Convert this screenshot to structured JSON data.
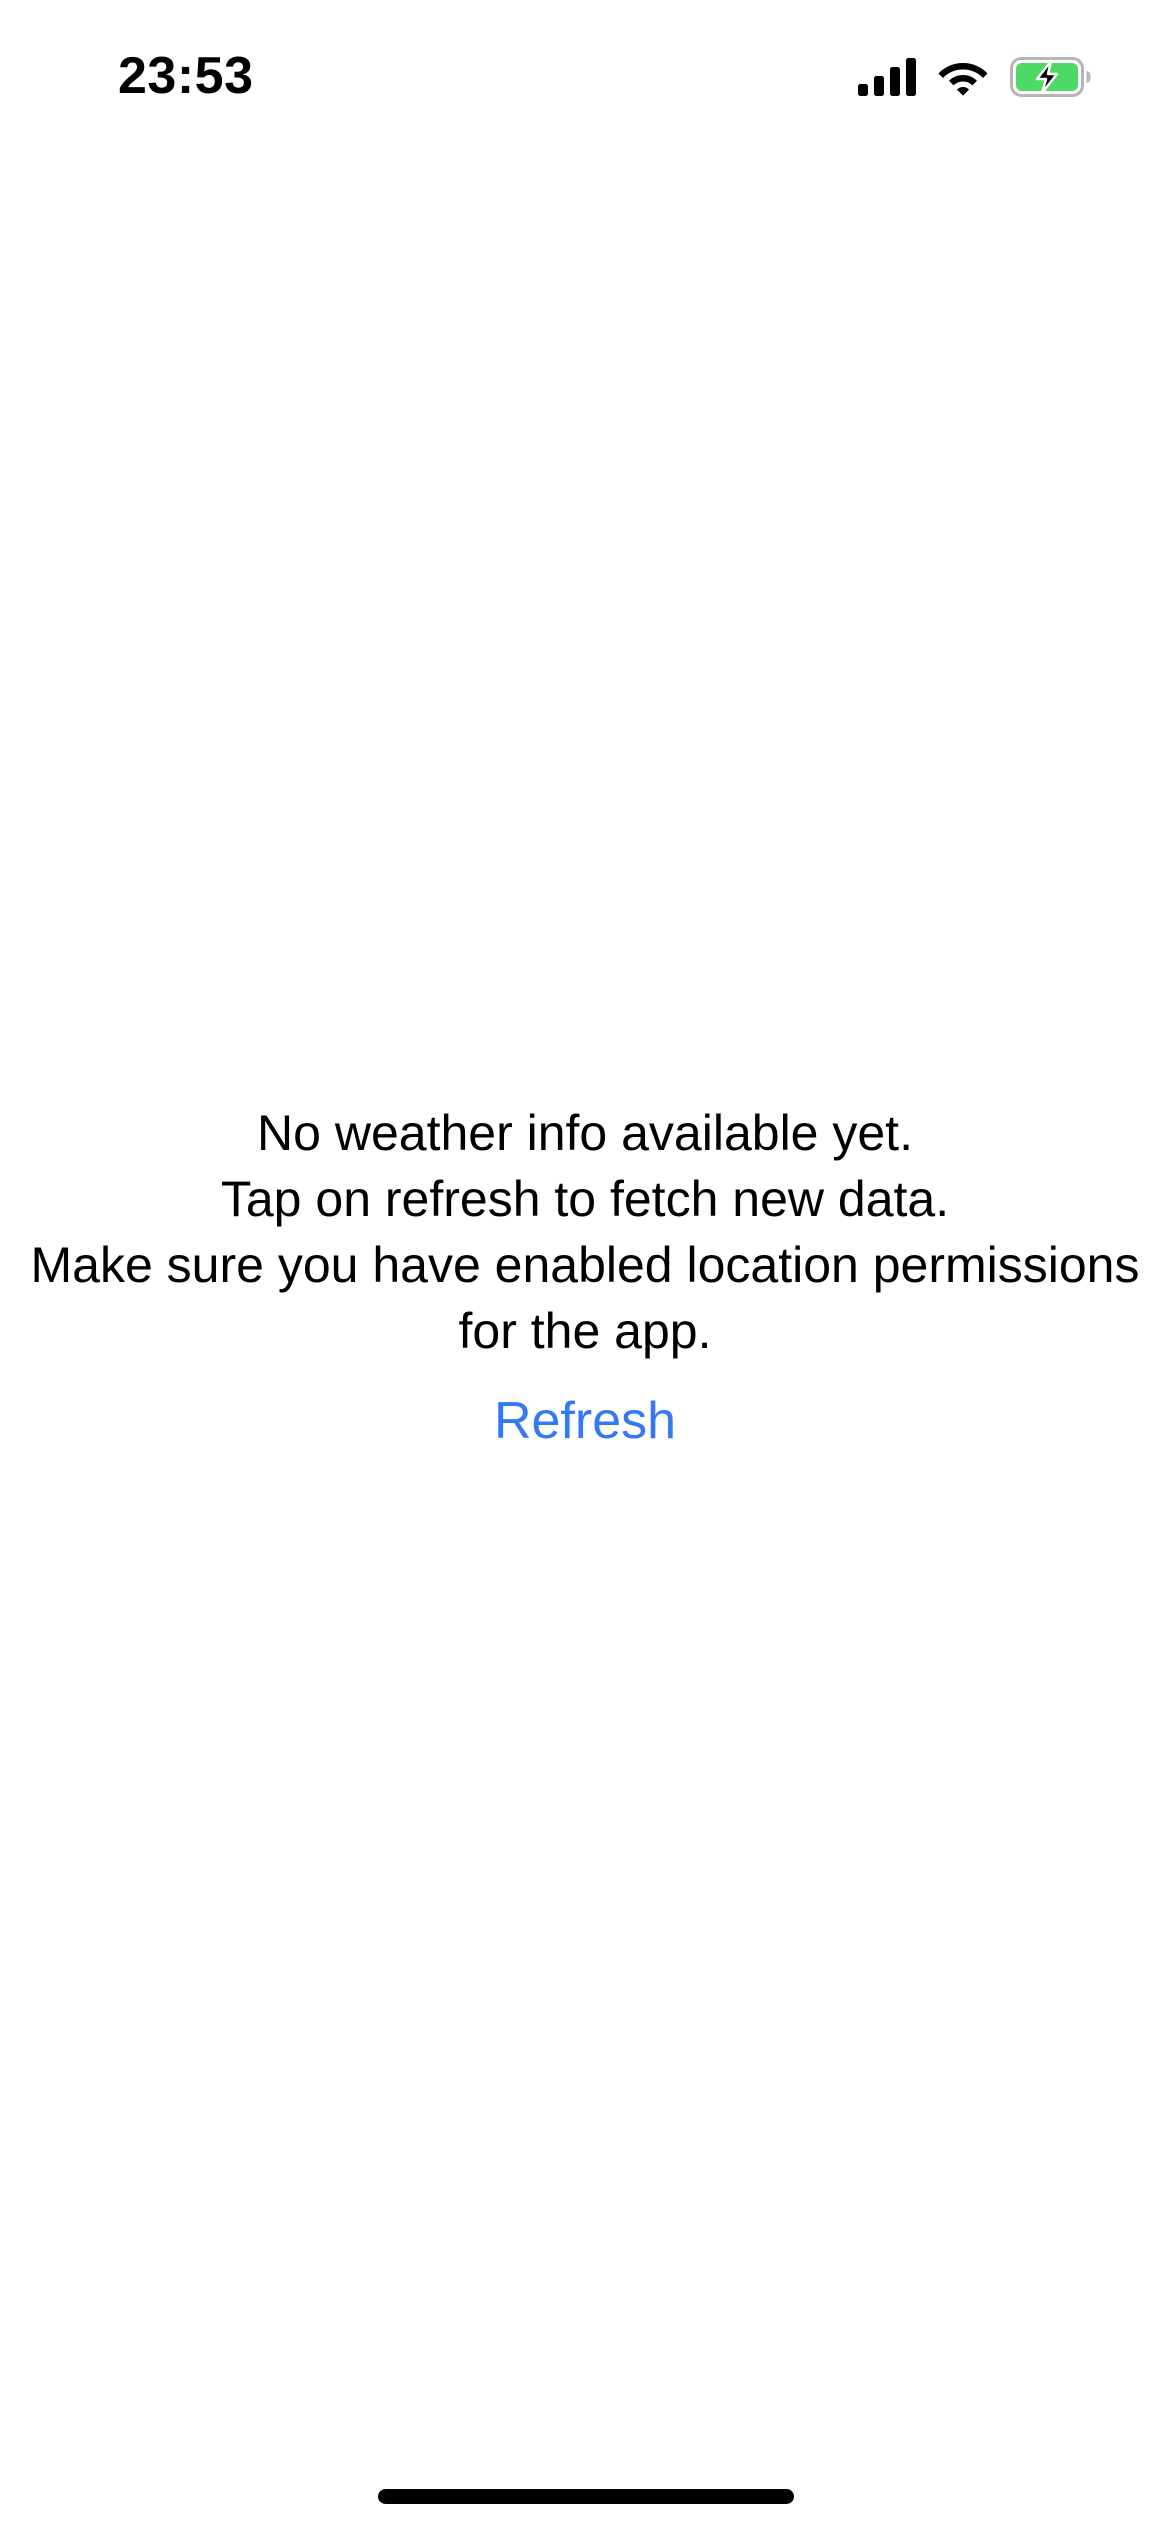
{
  "status_bar": {
    "time": "23:53",
    "icons": [
      "cellular-signal-icon",
      "wifi-icon",
      "battery-charging-icon"
    ],
    "battery_color": "#4cd964"
  },
  "empty_state": {
    "lines": [
      "No weather info available yet.",
      "Tap on refresh to fetch new data.",
      "Make sure you have enabled location permissions",
      "for the app."
    ],
    "refresh_label": "Refresh",
    "accent_color": "#3478f6"
  }
}
